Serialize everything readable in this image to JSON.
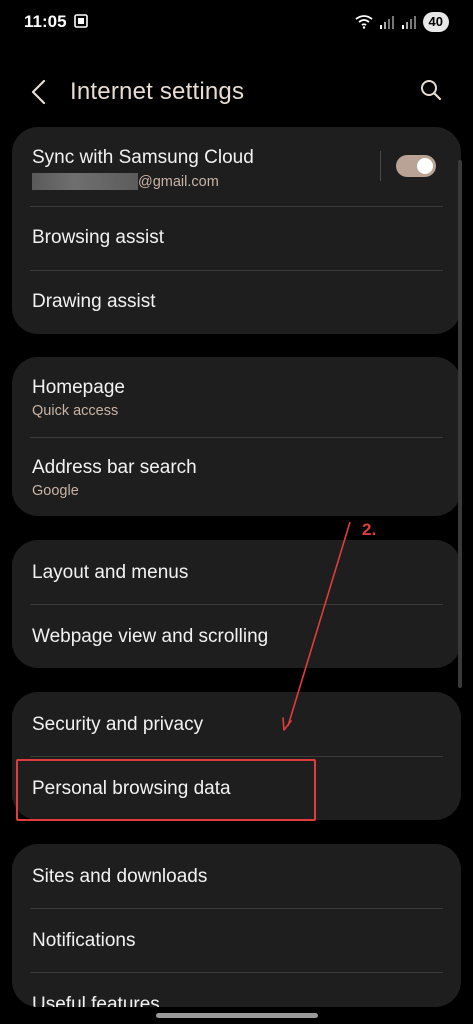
{
  "status_bar": {
    "time": "11:05",
    "battery": "40"
  },
  "header": {
    "title": "Internet settings"
  },
  "cards": [
    {
      "rows": [
        {
          "title": "Sync with Samsung Cloud",
          "email_domain": "@gmail.com",
          "toggle_on": true
        },
        {
          "title": "Browsing assist"
        },
        {
          "title": "Drawing assist"
        }
      ]
    },
    {
      "rows": [
        {
          "title": "Homepage",
          "subtitle": "Quick access"
        },
        {
          "title": "Address bar search",
          "subtitle": "Google"
        }
      ]
    },
    {
      "rows": [
        {
          "title": "Layout and menus"
        },
        {
          "title": "Webpage view and scrolling"
        }
      ]
    },
    {
      "rows": [
        {
          "title": "Security and privacy"
        },
        {
          "title": "Personal browsing data"
        }
      ]
    },
    {
      "rows": [
        {
          "title": "Sites and downloads"
        },
        {
          "title": "Notifications"
        },
        {
          "title": "Useful features"
        }
      ]
    }
  ],
  "annotation": {
    "label": "2.",
    "color": "#e03c3c"
  },
  "icons": {
    "back": "chevron-left-icon",
    "search": "search-icon",
    "screen_record": "screen-record-icon",
    "wifi": "wifi-icon",
    "signal": "signal-icon"
  }
}
